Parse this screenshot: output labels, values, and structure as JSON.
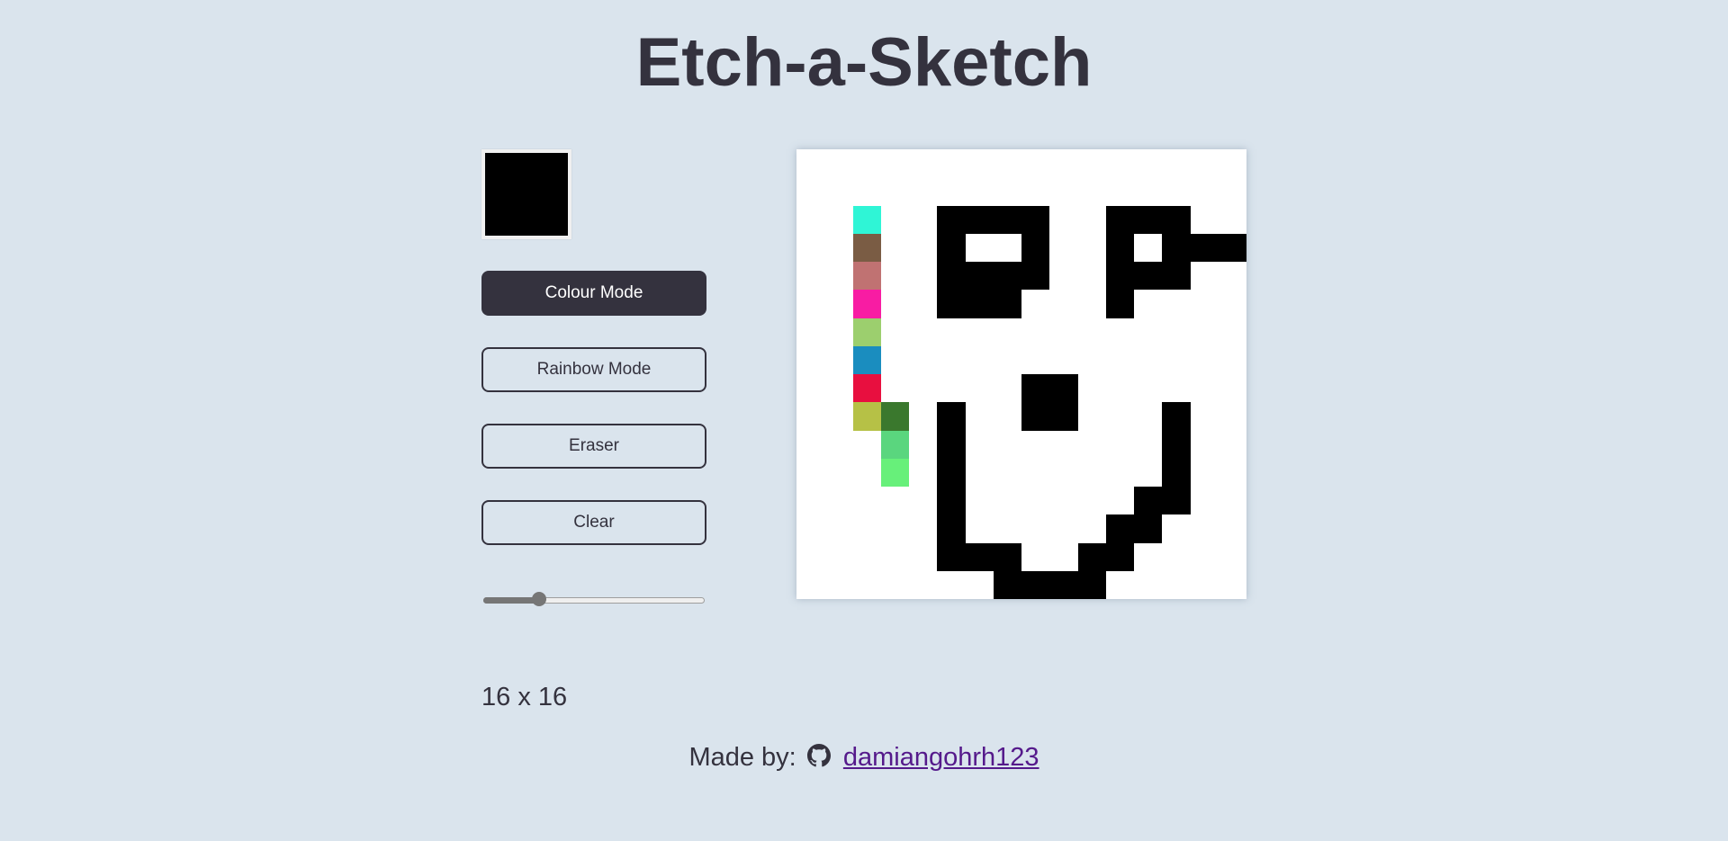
{
  "header": {
    "title": "Etch-a-Sketch"
  },
  "controls": {
    "current_color": "#000000",
    "buttons": [
      {
        "label": "Colour Mode",
        "active": true
      },
      {
        "label": "Rainbow Mode",
        "active": false
      },
      {
        "label": "Eraser",
        "active": false
      },
      {
        "label": "Clear",
        "active": false
      }
    ],
    "slider": {
      "min": 1,
      "max": 64,
      "value": 16
    },
    "size_label": "16 x 16"
  },
  "board": {
    "grid_size": 16,
    "background": "#ffffff",
    "colored_cells": [
      {
        "row": 2,
        "col": 2,
        "color": "#2ff5d6"
      },
      {
        "row": 3,
        "col": 2,
        "color": "#7a5c44"
      },
      {
        "row": 4,
        "col": 2,
        "color": "#c07272"
      },
      {
        "row": 5,
        "col": 2,
        "color": "#f81ca3"
      },
      {
        "row": 6,
        "col": 2,
        "color": "#9ccf6e"
      },
      {
        "row": 7,
        "col": 2,
        "color": "#1a8dbf"
      },
      {
        "row": 8,
        "col": 2,
        "color": "#e80f3f"
      },
      {
        "row": 9,
        "col": 2,
        "color": "#b6c146"
      },
      {
        "row": 9,
        "col": 3,
        "color": "#3a782d"
      },
      {
        "row": 10,
        "col": 3,
        "color": "#5ad67e"
      },
      {
        "row": 11,
        "col": 3,
        "color": "#67f07a"
      }
    ],
    "black_cells": [
      [
        2,
        5
      ],
      [
        2,
        6
      ],
      [
        2,
        7
      ],
      [
        2,
        8
      ],
      [
        2,
        11
      ],
      [
        2,
        12
      ],
      [
        2,
        13
      ],
      [
        3,
        5
      ],
      [
        3,
        8
      ],
      [
        3,
        11
      ],
      [
        3,
        13
      ],
      [
        3,
        14
      ],
      [
        3,
        15
      ],
      [
        4,
        5
      ],
      [
        4,
        6
      ],
      [
        4,
        7
      ],
      [
        4,
        8
      ],
      [
        4,
        11
      ],
      [
        4,
        12
      ],
      [
        4,
        13
      ],
      [
        5,
        5
      ],
      [
        5,
        6
      ],
      [
        5,
        7
      ],
      [
        5,
        11
      ],
      [
        8,
        8
      ],
      [
        8,
        9
      ],
      [
        9,
        5
      ],
      [
        9,
        8
      ],
      [
        9,
        9
      ],
      [
        9,
        13
      ],
      [
        10,
        5
      ],
      [
        10,
        13
      ],
      [
        11,
        5
      ],
      [
        11,
        13
      ],
      [
        12,
        5
      ],
      [
        12,
        12
      ],
      [
        12,
        13
      ],
      [
        13,
        5
      ],
      [
        13,
        11
      ],
      [
        13,
        12
      ],
      [
        14,
        5
      ],
      [
        14,
        6
      ],
      [
        14,
        7
      ],
      [
        14,
        10
      ],
      [
        14,
        11
      ],
      [
        15,
        7
      ],
      [
        15,
        8
      ],
      [
        15,
        9
      ],
      [
        15,
        10
      ]
    ]
  },
  "footer": {
    "prefix": "Made by:",
    "icon": "github-icon",
    "link_text": "damiangohrh123"
  }
}
